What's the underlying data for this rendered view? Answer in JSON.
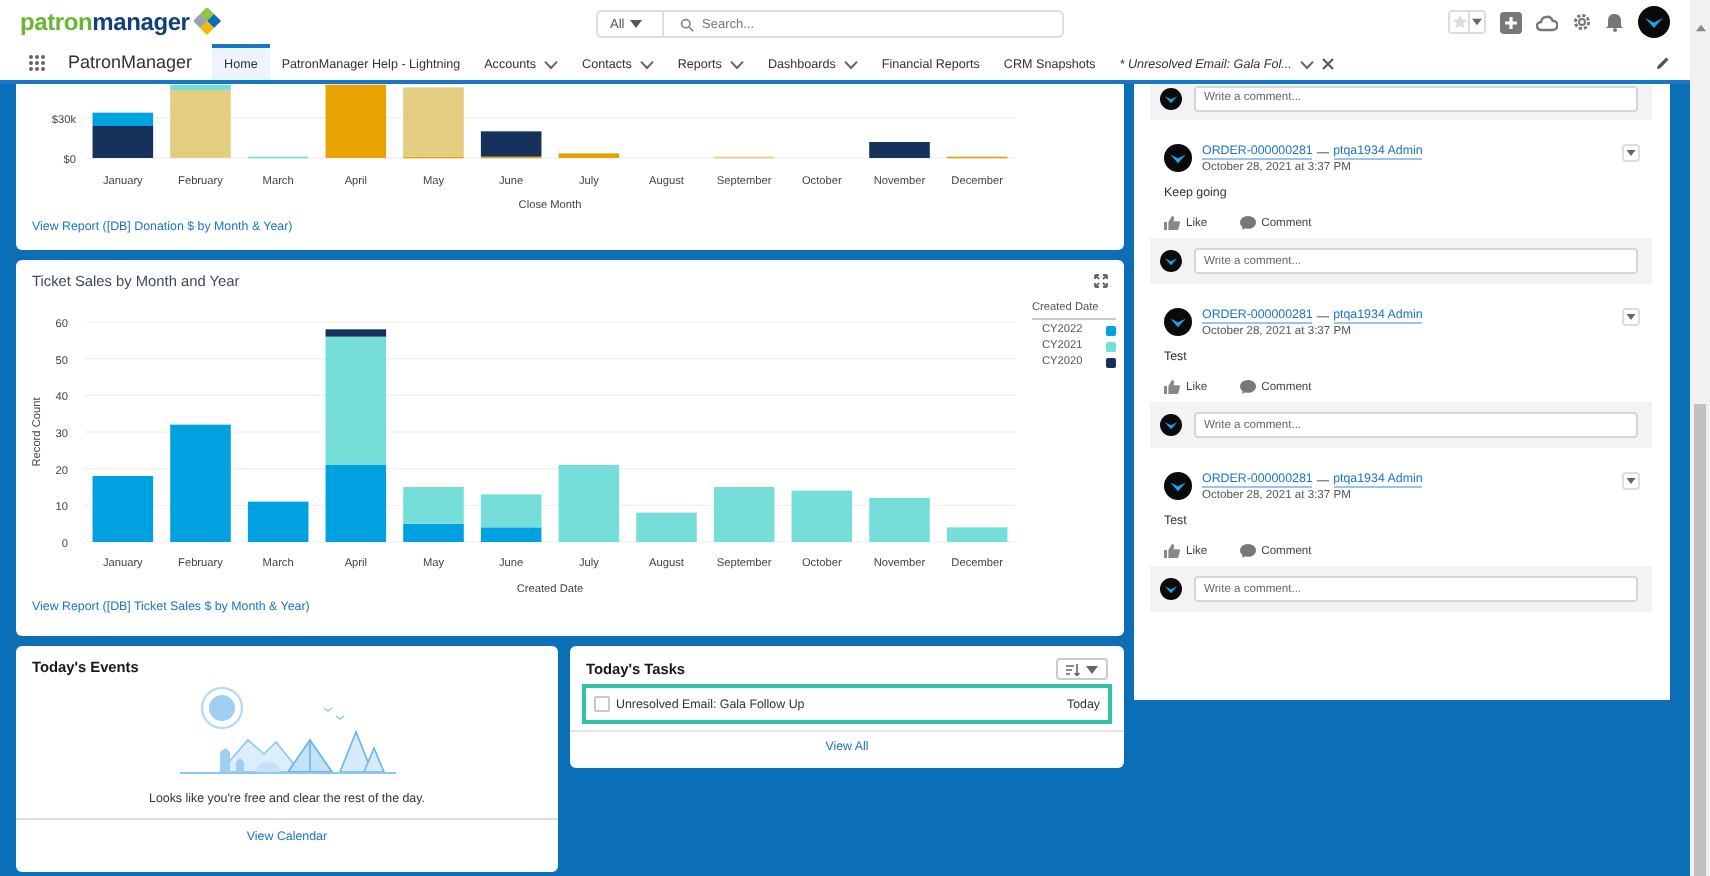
{
  "header": {
    "logo": [
      "patron",
      "manager"
    ],
    "search": {
      "scope": "All",
      "placeholder": "Search..."
    }
  },
  "nav": {
    "app_name": "PatronManager",
    "tabs": [
      {
        "label": "Home",
        "selected": true,
        "kind": "plain"
      },
      {
        "label": "PatronManager Help - Lightning",
        "selected": false,
        "kind": "plain"
      },
      {
        "label": "Accounts",
        "selected": false,
        "kind": "menu"
      },
      {
        "label": "Contacts",
        "selected": false,
        "kind": "menu"
      },
      {
        "label": "Reports",
        "selected": false,
        "kind": "menu"
      },
      {
        "label": "Dashboards",
        "selected": false,
        "kind": "menu"
      },
      {
        "label": "Financial Reports",
        "selected": false,
        "kind": "plain"
      },
      {
        "label": "CRM Snapshots",
        "selected": false,
        "kind": "plain"
      },
      {
        "label": "* Unresolved Email: Gala Fol...",
        "selected": false,
        "kind": "workspace"
      }
    ]
  },
  "donation_chart": {
    "link": "View Report ([DB] Donation $ by Month & Year)",
    "chart_data": {
      "type": "bar",
      "stacked": true,
      "xlabel": "Close Month",
      "categories": [
        "January",
        "February",
        "March",
        "April",
        "May",
        "June",
        "July",
        "August",
        "September",
        "October",
        "November",
        "December"
      ],
      "ylim": [
        0,
        55500
      ],
      "grid": true,
      "yticks": [
        {
          "value": 0,
          "label": "$0"
        },
        {
          "value": 30000,
          "label": "$30k"
        }
      ],
      "series": [
        {
          "color": "#e8a202",
          "values": [
            0,
            0,
            0,
            55000,
            1000,
            1000,
            3500,
            0,
            0,
            0,
            0,
            1000
          ]
        },
        {
          "color": "#e3cd81",
          "values": [
            0,
            51000,
            0,
            0,
            52000,
            0,
            0,
            0,
            1000,
            0,
            0,
            0
          ]
        },
        {
          "color": "#16325c",
          "values": [
            24000,
            0,
            0,
            0,
            0,
            19000,
            0,
            0,
            0,
            0,
            12000,
            0
          ]
        },
        {
          "color": "#00a1e0",
          "values": [
            10000,
            0,
            0,
            0,
            0,
            0,
            0,
            0,
            0,
            0,
            0,
            0
          ]
        },
        {
          "color": "#76ded9",
          "values": [
            0,
            4000,
            1000,
            0,
            0,
            0,
            0,
            0,
            0,
            0,
            0,
            0
          ]
        }
      ]
    }
  },
  "ticket_chart": {
    "title": "Ticket Sales by Month and Year",
    "legend_title": "Created Date",
    "link": "View Report ([DB] Ticket Sales $ by Month & Year)",
    "chart_data": {
      "type": "bar",
      "stacked": true,
      "xlabel": "Created Date",
      "ylabel": "Record Count",
      "categories": [
        "January",
        "February",
        "March",
        "April",
        "May",
        "June",
        "July",
        "August",
        "September",
        "October",
        "November",
        "December"
      ],
      "ylim": [
        0,
        60
      ],
      "grid": true,
      "yticks": [
        0,
        10,
        20,
        30,
        40,
        50,
        60
      ],
      "series": [
        {
          "name": "CY2022",
          "color": "#00a1e0",
          "values": [
            18,
            32,
            11,
            21,
            5,
            4,
            0,
            0,
            0,
            0,
            0,
            0
          ]
        },
        {
          "name": "CY2021",
          "color": "#76ded9",
          "values": [
            0,
            0,
            0,
            35,
            10,
            9,
            21,
            8,
            15,
            14,
            12,
            4
          ]
        },
        {
          "name": "CY2020",
          "color": "#16325c",
          "values": [
            0,
            0,
            0,
            2,
            0,
            0,
            0,
            0,
            0,
            0,
            0,
            0
          ]
        }
      ]
    }
  },
  "events": {
    "title": "Today's Events",
    "message": "Looks like you're free and clear the rest of the day.",
    "link": "View Calendar"
  },
  "tasks": {
    "title": "Today's Tasks",
    "items": [
      {
        "label": "Unresolved Email: Gala Follow Up",
        "due": "Today",
        "checked": false,
        "highlighted": true
      }
    ],
    "link": "View All"
  },
  "feed": {
    "top_comment_placeholder": "Write a comment...",
    "posts": [
      {
        "record": "ORDER-000000281",
        "separator": "—",
        "author": "ptqa1934 Admin",
        "date": "October 28, 2021 at 3:37 PM",
        "body": "Keep going",
        "actions": [
          "Like",
          "Comment"
        ],
        "comment_placeholder": "Write a comment..."
      },
      {
        "record": "ORDER-000000281",
        "separator": "—",
        "author": "ptqa1934 Admin",
        "date": "October 28, 2021 at 3:37 PM",
        "body": "Test",
        "actions": [
          "Like",
          "Comment"
        ],
        "comment_placeholder": "Write a comment..."
      },
      {
        "record": "ORDER-000000281",
        "separator": "—",
        "author": "ptqa1934 Admin",
        "date": "October 28, 2021 at 3:37 PM",
        "body": "Test",
        "actions": [
          "Like",
          "Comment"
        ],
        "comment_placeholder": "Write a comment..."
      }
    ]
  }
}
